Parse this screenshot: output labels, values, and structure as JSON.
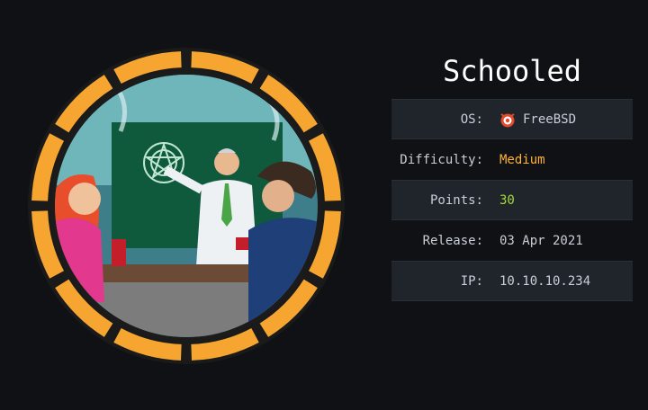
{
  "machine": {
    "name": "Schooled",
    "info": [
      {
        "label": "OS:",
        "value": "FreeBSD",
        "icon": "freebsd-icon"
      },
      {
        "label": "Difficulty:",
        "value": "Medium",
        "color": "#ffb235"
      },
      {
        "label": "Points:",
        "value": "30",
        "color": "#a4d93a"
      },
      {
        "label": "Release:",
        "value": "03 Apr 2021"
      },
      {
        "label": "IP:",
        "value": "10.10.10.234"
      }
    ]
  },
  "colors": {
    "background": "#0f1115",
    "badge_ring": "#f7a531",
    "medium": "#ffb235",
    "points": "#a4d93a"
  }
}
